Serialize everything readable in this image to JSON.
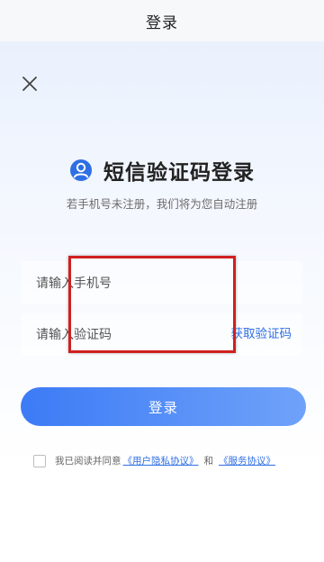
{
  "header": {
    "title": "登录"
  },
  "main": {
    "heading": "短信验证码登录",
    "subtitle": "若手机号未注册，我们将为您自动注册",
    "phone_placeholder": "请输入手机号",
    "code_placeholder": "请输入验证码",
    "get_code_label": "获取验证码",
    "login_label": "登录"
  },
  "agreement": {
    "prefix": "我已阅读并同意",
    "privacy_link": "《用户隐私协议》",
    "and": "和",
    "service_link": "《服务协议》",
    "checked": false
  },
  "colors": {
    "accent": "#2f6fe4",
    "button_start": "#3c7bf6",
    "button_end": "#6fa2f9",
    "highlight": "#d0201f"
  },
  "icons": {
    "close": "close-icon",
    "heading": "user-circle-icon"
  }
}
